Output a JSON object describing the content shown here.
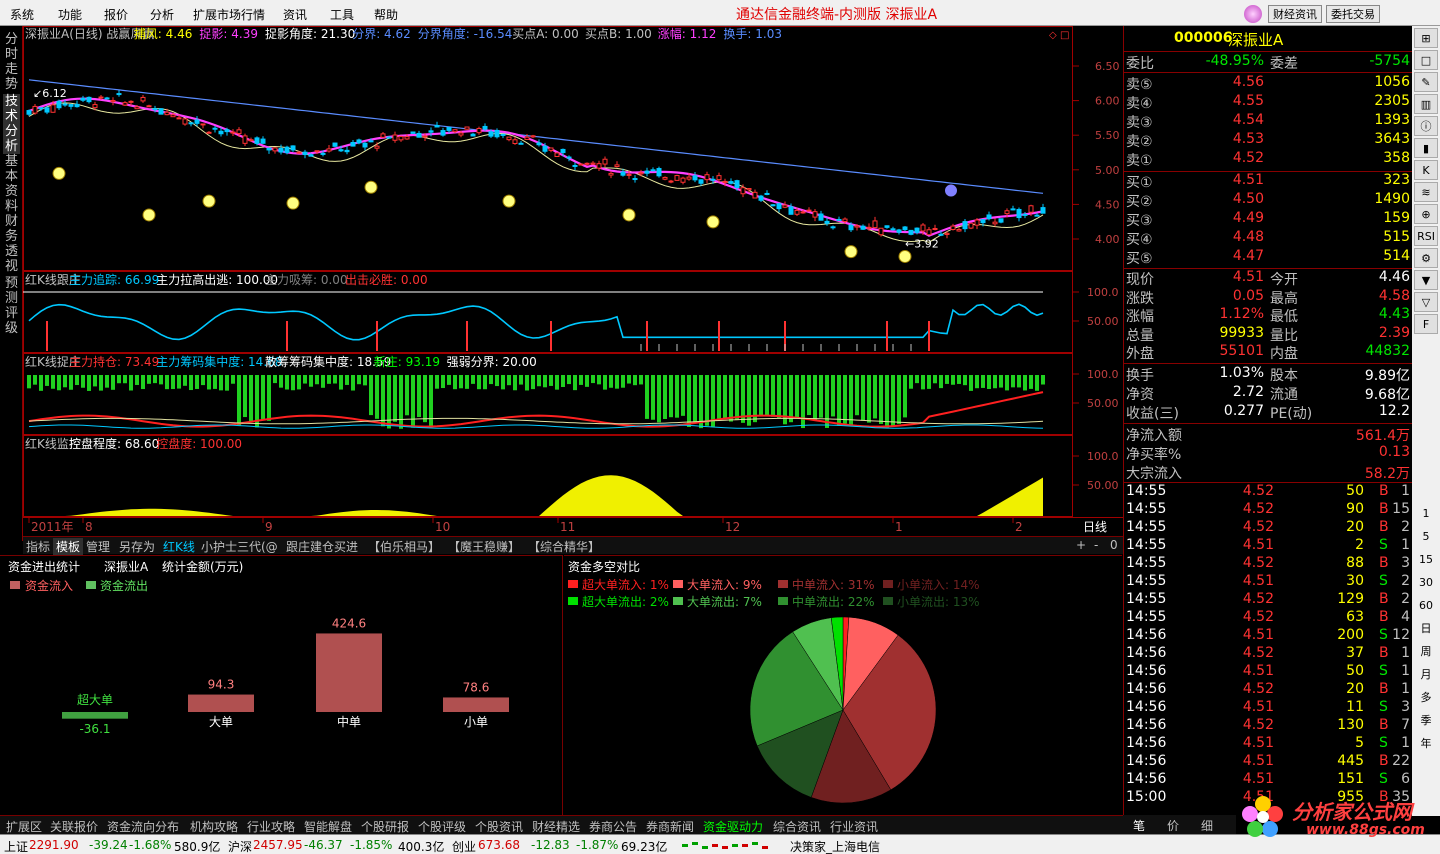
{
  "menubar": {
    "items": [
      "系统",
      "功能",
      "报价",
      "分析",
      "扩展市场行情",
      "资讯",
      "工具",
      "帮助"
    ],
    "title": "通达信金融终端-内测版  深振业A",
    "btn_finance": "财经资讯",
    "btn_trade": "委托交易",
    "brand": "www.88gs.com"
  },
  "left_tabs": [
    "分时走势",
    "技术分析",
    "基本资料",
    "财务透视",
    "预测评级"
  ],
  "main_chart": {
    "header": [
      {
        "t": "深振业A(日线)  战赢风赢",
        "c": "#c0c0c0"
      },
      {
        "t": "捕风: 4.46",
        "c": "#ffff00"
      },
      {
        "t": "捉影: 4.39",
        "c": "#ff40ff"
      },
      {
        "t": "捉影角度: 21.30",
        "c": "#ffffff"
      },
      {
        "t": "分界: 4.62",
        "c": "#5a8cff"
      },
      {
        "t": "分界角度: -16.54",
        "c": "#5a8cff"
      },
      {
        "t": "买点A: 0.00",
        "c": "#c0c0c0"
      },
      {
        "t": "买点B: 1.00",
        "c": "#c0c0c0"
      },
      {
        "t": "涨幅: 1.12",
        "c": "#ff40ff"
      },
      {
        "t": "换手: 1.03",
        "c": "#5a8cff"
      }
    ],
    "y_ticks": [
      "6.50",
      "6.00",
      "5.50",
      "5.00",
      "4.50",
      "4.00"
    ],
    "high_label": "6.12",
    "low_label": "3.92"
  },
  "panel2": {
    "header": [
      {
        "t": "红K线跟庄",
        "c": "#c0c0c0"
      },
      {
        "t": "主力追踪: 66.99",
        "c": "#00c8ff"
      },
      {
        "t": "主力拉高出逃: 100.00",
        "c": "#ffffff"
      },
      {
        "t": "主力吸筹: 0.00",
        "c": "#808080"
      },
      {
        "t": "出击必胜: 0.00",
        "c": "#ff3232"
      }
    ],
    "y_ticks": [
      "100.0",
      "50.00"
    ]
  },
  "panel3": {
    "header": [
      {
        "t": "红K线捉庄",
        "c": "#c0c0c0"
      },
      {
        "t": "主力持仓: 73.49",
        "c": "#ff3232"
      },
      {
        "t": "主力筹码集中度: 14.68",
        "c": "#00c8ff"
      },
      {
        "t": "散筹筹码集中度: 18.59",
        "c": "#ffffff"
      },
      {
        "t": "新庄: 93.19",
        "c": "#00ff00"
      },
      {
        "t": "强弱分界: 20.00",
        "c": "#ffffff"
      }
    ],
    "y_ticks": [
      "100.0",
      "50.00"
    ]
  },
  "panel4": {
    "header": [
      {
        "t": "红K线监控",
        "c": "#c0c0c0"
      },
      {
        "t": "控盘程度: 68.60",
        "c": "#ffffff"
      },
      {
        "t": "控盘度: 100.00",
        "c": "#ff3232"
      }
    ],
    "y_ticks": [
      "100.0",
      "50.00"
    ]
  },
  "x_axis": {
    "labels": [
      "2011年",
      "8",
      "9",
      "10",
      "11",
      "12",
      "1",
      "2"
    ],
    "period": "日线"
  },
  "bottom_tabs": [
    "指标",
    "模板",
    "管理",
    "另存为",
    "红K线",
    "小护士三代(@",
    "跟庄建仓买进",
    "【伯乐相马】",
    "【魔王稳赚】",
    "【综合精华】"
  ],
  "bottom_ctrl": [
    "+",
    "-",
    "0"
  ],
  "fund_stat": {
    "title": "资金进出统计",
    "stock": "深振业A",
    "unit": "统计金额(万元)",
    "legend_in": "资金流入",
    "legend_out": "资金流出",
    "bars": [
      {
        "label": "超大单",
        "value": "-36.1"
      },
      {
        "label": "大单",
        "value": "94.3"
      },
      {
        "label": "中单",
        "value": "424.6"
      },
      {
        "label": "小单",
        "value": "78.6"
      }
    ]
  },
  "fund_pie": {
    "title": "资金多空对比",
    "inflow": [
      {
        "label": "超大单流入:",
        "pct": "1%",
        "color": "#ff2020"
      },
      {
        "label": "大单流入:",
        "pct": "9%",
        "color": "#ff6060"
      },
      {
        "label": "中单流入:",
        "pct": "31%",
        "color": "#a03030"
      },
      {
        "label": "小单流入:",
        "pct": "14%",
        "color": "#702020"
      }
    ],
    "outflow": [
      {
        "label": "超大单流出:",
        "pct": "2%",
        "color": "#00e000"
      },
      {
        "label": "大单流出:",
        "pct": "7%",
        "color": "#50c050"
      },
      {
        "label": "中单流出:",
        "pct": "22%",
        "color": "#309030"
      },
      {
        "label": "小单流出:",
        "pct": "13%",
        "color": "#205020"
      }
    ]
  },
  "quote": {
    "code": "000006",
    "name": "深振业A",
    "wb_label": "委比",
    "wb": "-48.95%",
    "wc_label": "委差",
    "wc": "-5754",
    "asks": [
      {
        "l": "卖⑤",
        "p": "4.56",
        "v": "1056"
      },
      {
        "l": "卖④",
        "p": "4.55",
        "v": "2305"
      },
      {
        "l": "卖③",
        "p": "4.54",
        "v": "1393"
      },
      {
        "l": "卖②",
        "p": "4.53",
        "v": "3643"
      },
      {
        "l": "卖①",
        "p": "4.52",
        "v": "358"
      }
    ],
    "bids": [
      {
        "l": "买①",
        "p": "4.51",
        "v": "323"
      },
      {
        "l": "买②",
        "p": "4.50",
        "v": "1490"
      },
      {
        "l": "买③",
        "p": "4.49",
        "v": "159"
      },
      {
        "l": "买④",
        "p": "4.48",
        "v": "515"
      },
      {
        "l": "买⑤",
        "p": "4.47",
        "v": "514"
      }
    ],
    "stats": [
      [
        "现价",
        "4.51",
        "今开",
        "4.46"
      ],
      [
        "涨跌",
        "0.05",
        "最高",
        "4.58"
      ],
      [
        "涨幅",
        "1.12%",
        "最低",
        "4.43"
      ],
      [
        "总量",
        "99933",
        "量比",
        "2.39"
      ],
      [
        "外盘",
        "55101",
        "内盘",
        "44832"
      ]
    ],
    "stats2": [
      [
        "换手",
        "1.03%",
        "股本",
        "9.89亿"
      ],
      [
        "净资",
        "2.72",
        "流通",
        "9.68亿"
      ],
      [
        "收益(三)",
        "0.277",
        "PE(动)",
        "12.2"
      ]
    ],
    "flow": [
      [
        "净流入额",
        "561.4万"
      ],
      [
        "净买率%",
        "0.13"
      ],
      [
        "大宗流入",
        "58.2万"
      ]
    ],
    "ticks": [
      [
        "14:55",
        "4.52",
        "50",
        "B",
        "1"
      ],
      [
        "14:55",
        "4.52",
        "90",
        "B",
        "15"
      ],
      [
        "14:55",
        "4.52",
        "20",
        "B",
        "2"
      ],
      [
        "14:55",
        "4.51",
        "2",
        "S",
        "1"
      ],
      [
        "14:55",
        "4.52",
        "88",
        "B",
        "3"
      ],
      [
        "14:55",
        "4.51",
        "30",
        "S",
        "2"
      ],
      [
        "14:55",
        "4.52",
        "129",
        "B",
        "2"
      ],
      [
        "14:55",
        "4.52",
        "63",
        "B",
        "4"
      ],
      [
        "14:56",
        "4.51",
        "200",
        "S",
        "12"
      ],
      [
        "14:56",
        "4.52",
        "37",
        "B",
        "1"
      ],
      [
        "14:56",
        "4.51",
        "50",
        "S",
        "1"
      ],
      [
        "14:56",
        "4.52",
        "20",
        "B",
        "1"
      ],
      [
        "14:56",
        "4.51",
        "11",
        "S",
        "3"
      ],
      [
        "14:56",
        "4.52",
        "130",
        "B",
        "7"
      ],
      [
        "14:56",
        "4.51",
        "5",
        "S",
        "1"
      ],
      [
        "14:56",
        "4.51",
        "445",
        "B",
        "22"
      ],
      [
        "14:56",
        "4.51",
        "151",
        "S",
        "6"
      ],
      [
        "15:00",
        "4.51",
        "955",
        "B",
        "35"
      ]
    ]
  },
  "right_tools": [
    "1",
    "5",
    "15",
    "30",
    "60",
    "日",
    "周",
    "月",
    "多",
    "季",
    "年"
  ],
  "func_bar": [
    "扩展区",
    "关联报价",
    "资金流向分布",
    "机构攻略",
    "行业攻略",
    "智能解盘",
    "个股研报",
    "个股评级",
    "个股资讯",
    "财经精选",
    "券商公告",
    "券商新闻",
    "资金驱动力",
    "综合资讯",
    "行业资讯"
  ],
  "tick_tabs": [
    "笔",
    "价",
    "细"
  ],
  "status": {
    "sh": "上证",
    "sh_v": "2291.90",
    "sh_c": "-39.24",
    "sh_p": "-1.68%",
    "sh_a": "580.9亿",
    "hs": "沪深",
    "hs_v": "2457.95",
    "hs_c": "-46.37",
    "hs_p": "-1.85%",
    "hs_a": "400.3亿",
    "cy": "创业",
    "cy_v": "673.68",
    "cy_c": "-12.83",
    "cy_p": "-1.87%",
    "cy_a": "69.23亿",
    "info": "决策家_上海电信"
  },
  "watermark": {
    "text": "分析家公式网",
    "url": "www.88gs.com"
  },
  "colors": {
    "up": "#ff3232",
    "down": "#00e600",
    "ma_magenta": "#ff40ff",
    "ma_blue": "#5a8cff",
    "yellow": "#ffff00",
    "cyan": "#00c8ff"
  }
}
